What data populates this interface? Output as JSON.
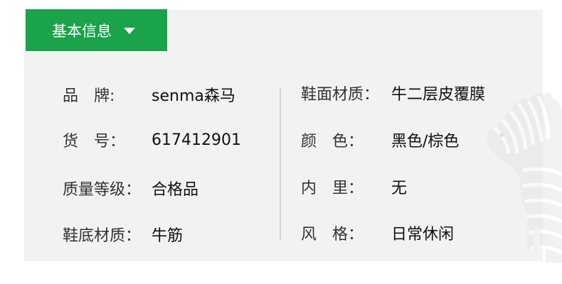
{
  "tab": {
    "label": "基本信息",
    "icon": "caret-down-icon"
  },
  "colors": {
    "tab_bg": "#1aa34a",
    "panel_bg": "#f2f2f2",
    "divider": "#d6d6d6"
  },
  "left_attributes": [
    {
      "label": "品　牌:",
      "value": "senma森马"
    },
    {
      "label": "货　号：",
      "value": "617412901"
    },
    {
      "label": "质量等级：",
      "value": "合格品"
    },
    {
      "label": "鞋底材质：",
      "value": "牛筋"
    }
  ],
  "right_attributes": [
    {
      "label": "鞋面材质：",
      "value": "牛二层皮覆膜"
    },
    {
      "label": "颜　色：",
      "value": "黑色/棕色"
    },
    {
      "label": "内　里：",
      "value": "无"
    },
    {
      "label": "风　格：",
      "value": "日常休闲"
    }
  ],
  "decoration": {
    "icon": "zebra-watermark-icon"
  }
}
